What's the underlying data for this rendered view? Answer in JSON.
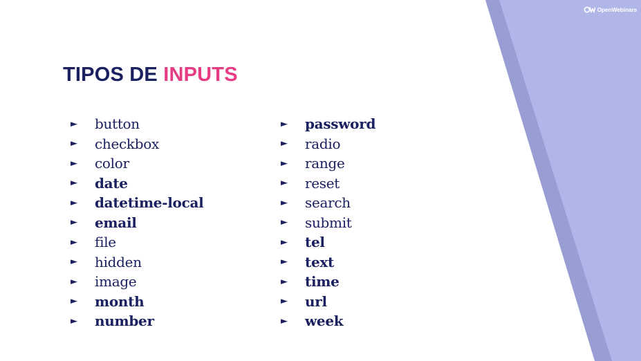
{
  "brand": {
    "logo_text": "OpenWebinars",
    "accent_color": "#e63c84",
    "primary_color": "#1b2060",
    "decor_light": "#b0b6e8",
    "decor_dark": "#989ed4"
  },
  "title": {
    "part1": "TIPOS DE ",
    "part2": "INPUTS"
  },
  "bullet_icon": "triangle-right-icon",
  "left_column": [
    {
      "bullet": "►",
      "label": "button",
      "bold": false
    },
    {
      "bullet": "►",
      "label": "checkbox",
      "bold": false
    },
    {
      "bullet": "►",
      "label": "color",
      "bold": false
    },
    {
      "bullet": "►",
      "label": "date",
      "bold": true
    },
    {
      "bullet": "►",
      "label": "datetime-local",
      "bold": true
    },
    {
      "bullet": "►",
      "label": "email",
      "bold": true
    },
    {
      "bullet": "►",
      "label": "file",
      "bold": false
    },
    {
      "bullet": "►",
      "label": "hidden",
      "bold": false
    },
    {
      "bullet": "►",
      "label": "image",
      "bold": false
    },
    {
      "bullet": "►",
      "label": "month",
      "bold": true
    },
    {
      "bullet": "►",
      "label": "number",
      "bold": true
    }
  ],
  "right_column": [
    {
      "bullet": "►",
      "label": "password",
      "bold": true
    },
    {
      "bullet": "►",
      "label": "radio",
      "bold": false
    },
    {
      "bullet": "►",
      "label": "range",
      "bold": false
    },
    {
      "bullet": "►",
      "label": "reset",
      "bold": false
    },
    {
      "bullet": "►",
      "label": "search",
      "bold": false
    },
    {
      "bullet": "►",
      "label": "submit",
      "bold": false
    },
    {
      "bullet": "►",
      "label": "tel",
      "bold": true
    },
    {
      "bullet": "►",
      "label": "text",
      "bold": true
    },
    {
      "bullet": "►",
      "label": "time",
      "bold": true
    },
    {
      "bullet": "►",
      "label": "url",
      "bold": true
    },
    {
      "bullet": "►",
      "label": "week",
      "bold": true
    }
  ]
}
